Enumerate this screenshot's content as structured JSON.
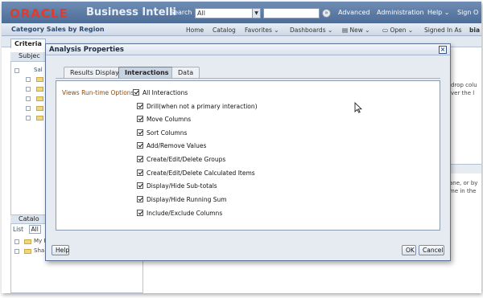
{
  "header": {
    "logo": "ORACLE",
    "product": "Business Intelli",
    "search_label": "Search",
    "search_scope": "All",
    "links": [
      "Advanced",
      "Administration",
      "Help",
      "Sign O"
    ]
  },
  "navbar": {
    "title": "Category Sales by Region",
    "links": [
      "Home",
      "Catalog",
      "Favorites",
      "Dashboards",
      "New",
      "Open",
      "Signed In As",
      "bia"
    ]
  },
  "workspace": {
    "criteria_tab": "Criteria",
    "subject_pane": "Subjec",
    "subject_item": "Sal",
    "catalog_pane": "Catalo",
    "list_label": "List",
    "list_value": "All",
    "catalog_items": [
      "My F",
      "Sha"
    ],
    "right_fragments": [
      "drop colu",
      "ver the l",
      "ane, or by",
      "me in the"
    ]
  },
  "dialog": {
    "title": "Analysis Properties",
    "tabs": [
      "Results Display",
      "Interactions",
      "Data"
    ],
    "active_tab": "Interactions",
    "section_label": "Views Run-time Options",
    "options": [
      {
        "label": "All Interactions",
        "checked": true
      },
      {
        "label": "Drill(when not a primary interaction)",
        "checked": true
      },
      {
        "label": "Move Columns",
        "checked": true
      },
      {
        "label": "Sort Columns",
        "checked": true
      },
      {
        "label": "Add/Remove Values",
        "checked": true
      },
      {
        "label": "Create/Edit/Delete Groups",
        "checked": true
      },
      {
        "label": "Create/Edit/Delete Calculated Items",
        "checked": true
      },
      {
        "label": "Display/Hide Sub-totals",
        "checked": true
      },
      {
        "label": "Display/Hide Running Sum",
        "checked": true
      },
      {
        "label": "Include/Exclude Columns",
        "checked": true
      }
    ],
    "help_button": "Help",
    "ok_button": "OK",
    "cancel_button": "Cancel"
  },
  "colors": {
    "header_bg": "#4d6c97",
    "logo_red": "#e03b2b",
    "section_label": "#8a4b0f"
  }
}
